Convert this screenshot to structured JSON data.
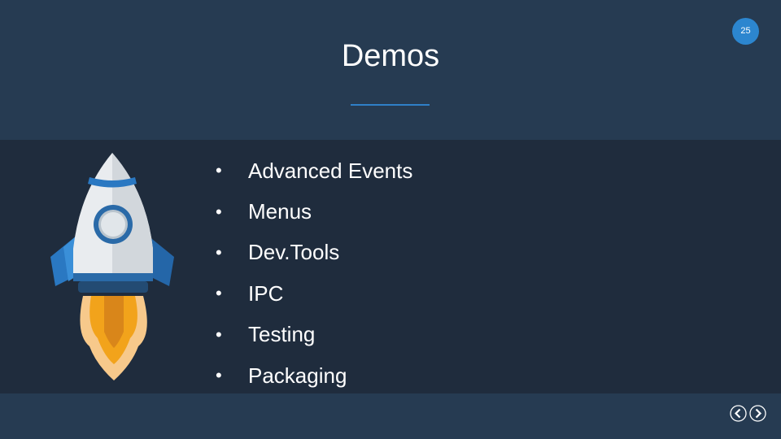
{
  "slide": {
    "title": "Demos",
    "page_number": "25"
  },
  "bullets": [
    "Advanced Events",
    "Menus",
    "Dev.Tools",
    "IPC",
    "Testing",
    "Packaging"
  ],
  "bullet_marker": "•",
  "colors": {
    "header_bg": "#263b52",
    "content_bg": "#1f2c3d",
    "accent_blue": "#2c86cf",
    "text": "#ffffff"
  },
  "icons": {
    "illustration": "rocket-icon",
    "prev": "chevron-left-circle-icon",
    "next": "chevron-right-circle-icon"
  }
}
